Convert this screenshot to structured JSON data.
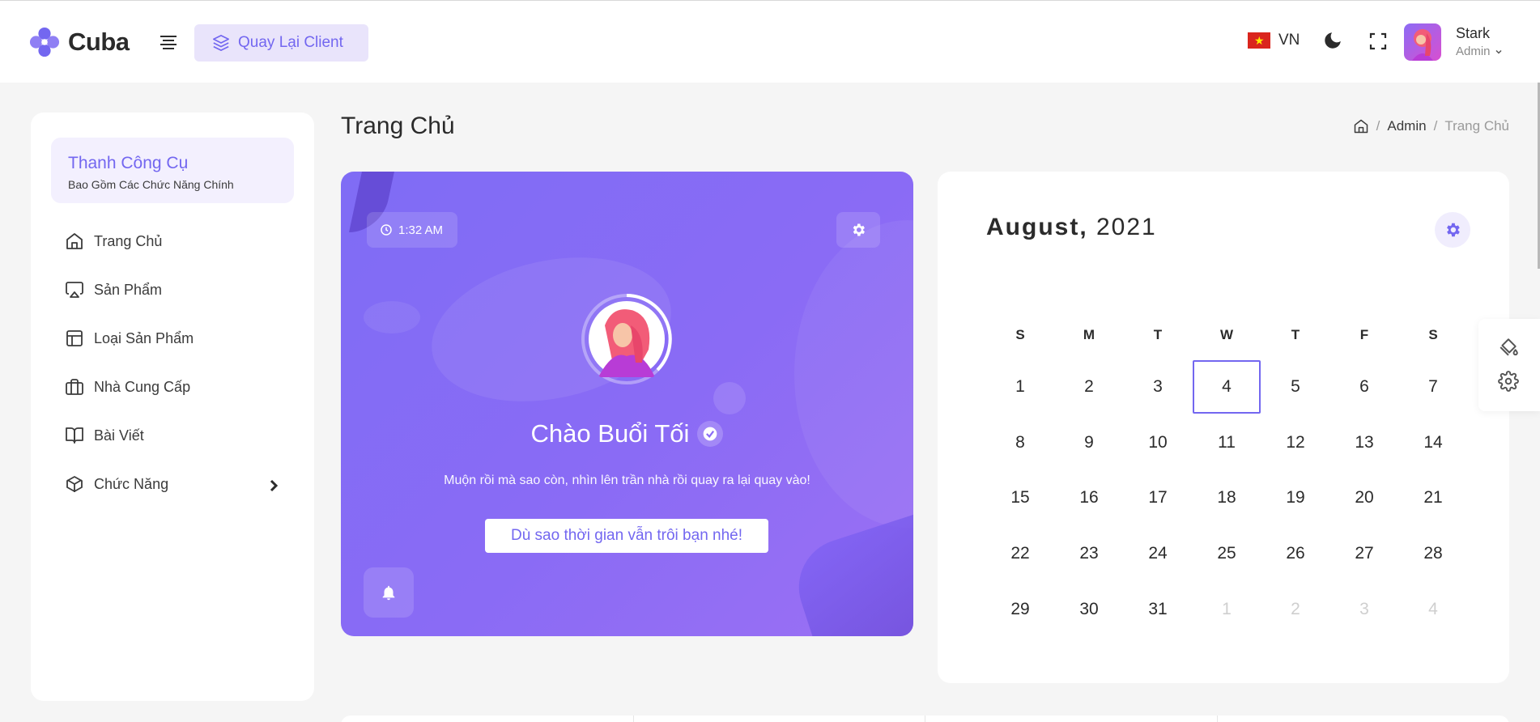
{
  "header": {
    "logo_text": "Cuba",
    "back_button_label": "Quay Lại Client",
    "language": "VN",
    "user": {
      "name": "Stark",
      "role": "Admin"
    }
  },
  "sidebar": {
    "card_title": "Thanh Công Cụ",
    "card_subtitle": "Bao Gồm Các Chức Năng Chính",
    "items": [
      {
        "label": "Trang Chủ",
        "icon": "home-icon"
      },
      {
        "label": "Sản Phẩm",
        "icon": "airplay-icon"
      },
      {
        "label": "Loại Sản Phẩm",
        "icon": "layout-icon"
      },
      {
        "label": "Nhà Cung Cấp",
        "icon": "briefcase-icon"
      },
      {
        "label": "Bài Viết",
        "icon": "book-open-icon"
      },
      {
        "label": "Chức Năng",
        "icon": "box-icon"
      }
    ]
  },
  "page": {
    "title": "Trang Chủ",
    "breadcrumb": [
      "Admin",
      "Trang Chủ"
    ]
  },
  "welcome": {
    "time": "1:32 AM",
    "greeting": "Chào Buổi Tối",
    "message": "Muộn rồi mà sao còn, nhìn lên trần nhà rồi quay ra lại quay vào!",
    "button_label": "Dù sao thời gian vẫn trôi bạn nhé!",
    "accent": "#7367f0"
  },
  "calendar": {
    "month": "August,",
    "year": "2021",
    "weekdays": [
      "S",
      "M",
      "T",
      "W",
      "T",
      "F",
      "S"
    ],
    "weeks": [
      [
        "1",
        "2",
        "3",
        "4",
        "5",
        "6",
        "7"
      ],
      [
        "8",
        "9",
        "10",
        "11",
        "12",
        "13",
        "14"
      ],
      [
        "15",
        "16",
        "17",
        "18",
        "19",
        "20",
        "21"
      ],
      [
        "22",
        "23",
        "24",
        "25",
        "26",
        "27",
        "28"
      ],
      [
        "29",
        "30",
        "31",
        "1",
        "2",
        "3",
        "4"
      ]
    ],
    "selected_day": "4",
    "muted_in_last_week_from_index": 3
  },
  "colors": {
    "accent": "#7367f0",
    "accent_light": "#e9e4fb",
    "background": "#f5f5f5"
  }
}
